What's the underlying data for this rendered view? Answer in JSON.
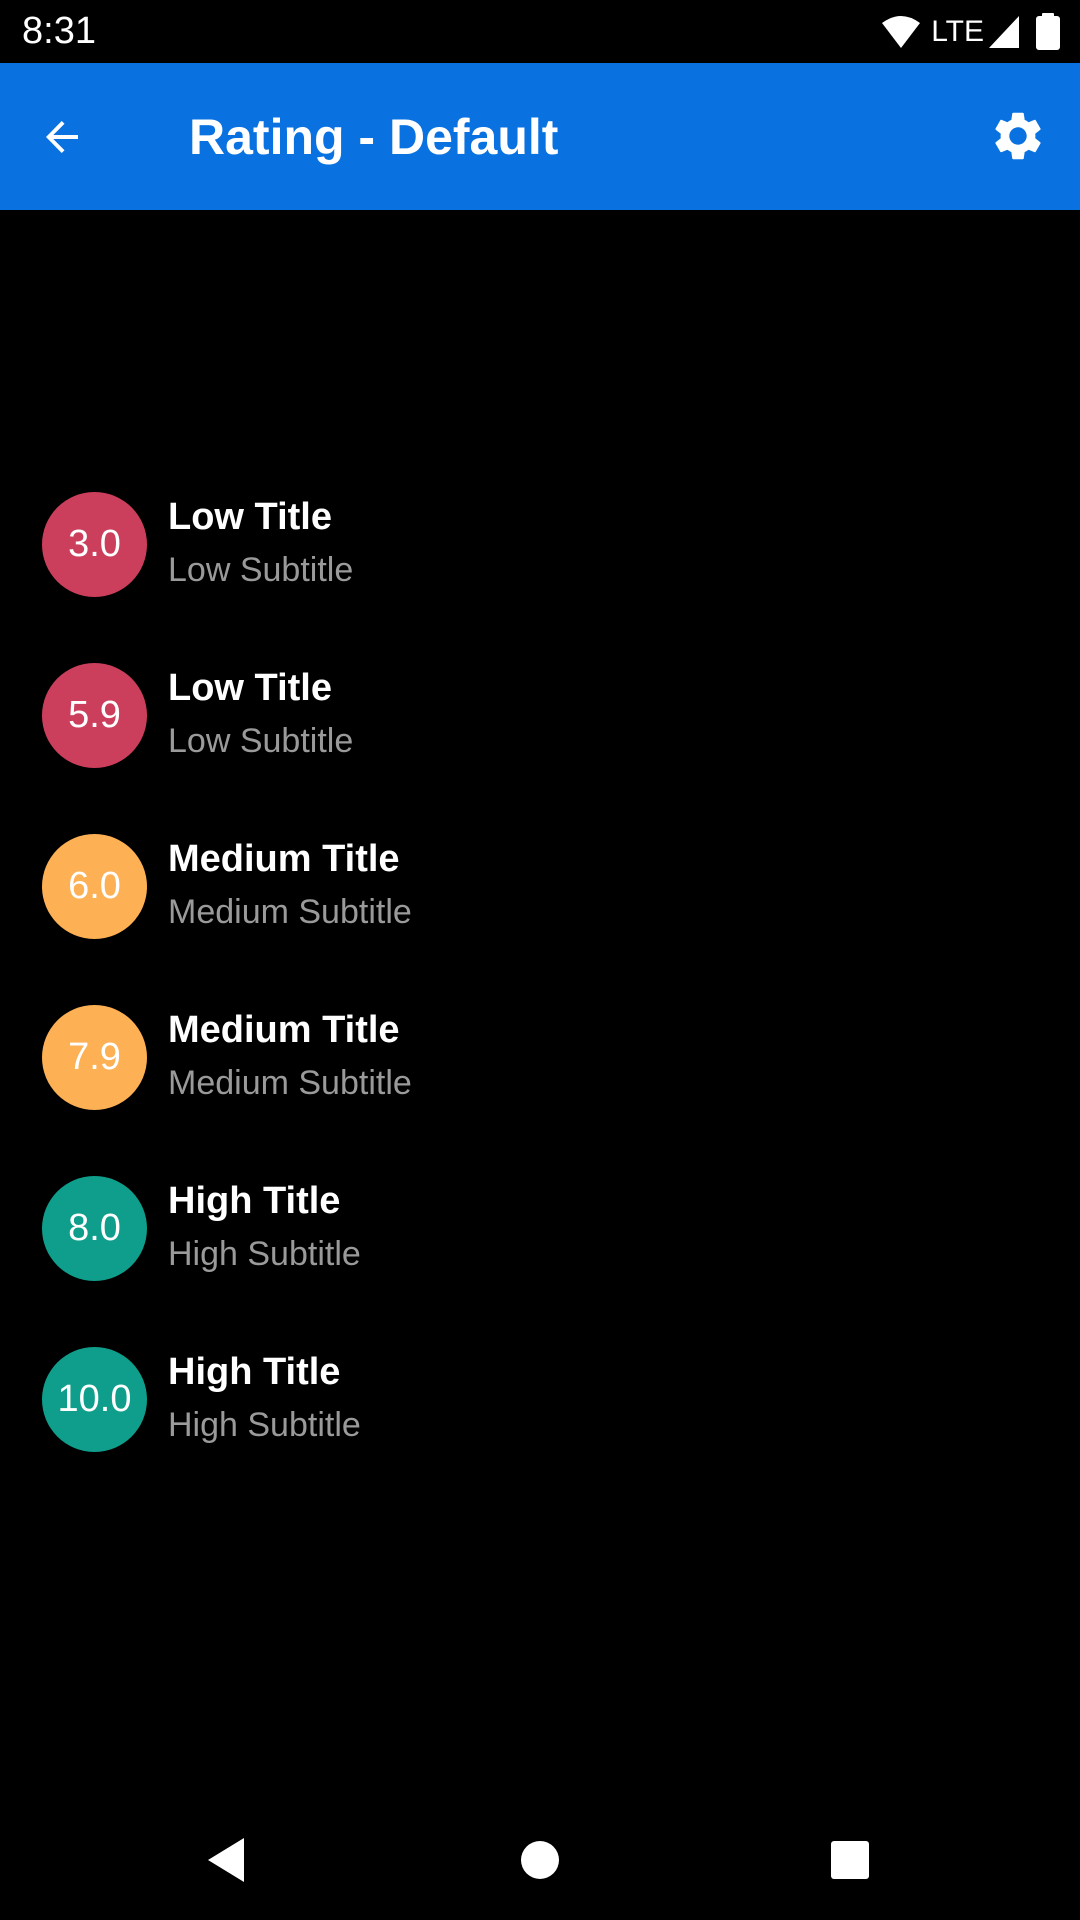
{
  "status_bar": {
    "time": "8:31",
    "network": "LTE",
    "icons": [
      "wifi-icon",
      "cell-signal-icon",
      "battery-icon"
    ]
  },
  "app_bar": {
    "title": "Rating - Default",
    "background_color": "#0a72e0",
    "back_icon": "arrow-back-icon",
    "settings_icon": "gear-icon"
  },
  "colors": {
    "low": "#cc3f5c",
    "medium": "#fdb054",
    "high": "#0e9e8b"
  },
  "ratings": [
    {
      "rating": "3.0",
      "level": "low",
      "title": "Low Title",
      "subtitle": "Low Subtitle"
    },
    {
      "rating": "5.9",
      "level": "low",
      "title": "Low Title",
      "subtitle": "Low Subtitle"
    },
    {
      "rating": "6.0",
      "level": "medium",
      "title": "Medium Title",
      "subtitle": "Medium Subtitle"
    },
    {
      "rating": "7.9",
      "level": "medium",
      "title": "Medium Title",
      "subtitle": "Medium Subtitle"
    },
    {
      "rating": "8.0",
      "level": "high",
      "title": "High Title",
      "subtitle": "High Subtitle"
    },
    {
      "rating": "10.0",
      "level": "high",
      "title": "High Title",
      "subtitle": "High Subtitle"
    }
  ],
  "nav_bar": {
    "buttons": [
      "nav-back-icon",
      "nav-home-icon",
      "nav-recents-icon"
    ]
  }
}
